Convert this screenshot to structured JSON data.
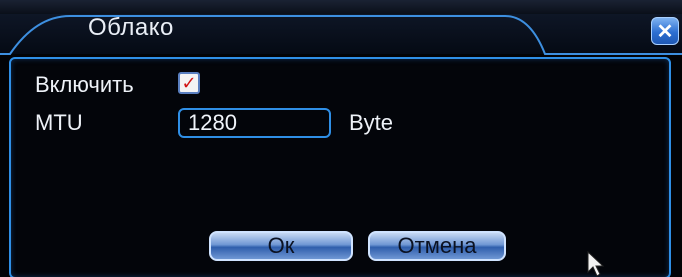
{
  "dialog": {
    "title": "Облако",
    "close_icon": "close-icon"
  },
  "form": {
    "enable_label": "Включить",
    "enable_checked": true,
    "mtu_label": "MTU",
    "mtu_value": "1280",
    "mtu_unit": "Byte"
  },
  "buttons": {
    "ok_label": "Ок",
    "cancel_label": "Отмена"
  },
  "colors": {
    "accent": "#2f8fe6",
    "background": "#03050a",
    "check": "#d21414"
  }
}
